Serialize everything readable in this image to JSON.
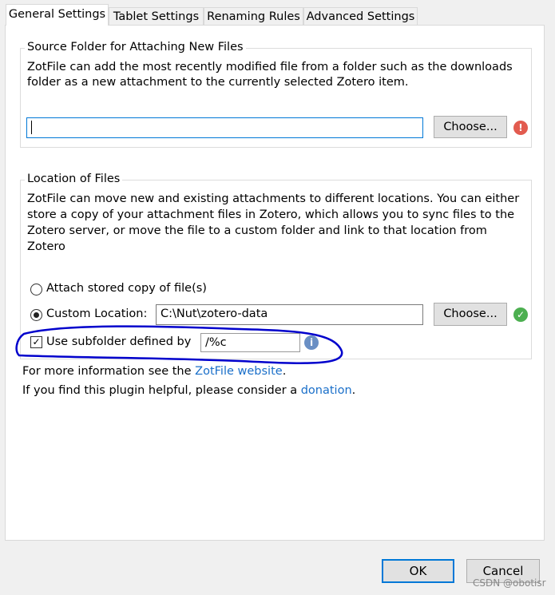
{
  "tabs": [
    {
      "label": "General Settings",
      "selected": true
    },
    {
      "label": "Tablet Settings"
    },
    {
      "label": "Renaming Rules"
    },
    {
      "label": "Advanced Settings"
    }
  ],
  "source": {
    "legend": "Source Folder for Attaching New Files",
    "desc1": "ZotFile can add the most recently modified file from a folder such as the downloads",
    "desc2": "folder as a new attachment to the currently selected Zotero item.",
    "value": "",
    "choose": "Choose...",
    "status_icon": "error-icon"
  },
  "location": {
    "legend": "Location of Files",
    "desc1": "ZotFile can move new and existing attachments to different locations. You can either",
    "desc2": "store a copy of your attachment files in Zotero, which allows you to sync files to the",
    "desc3": "Zotero server, or move the file to a custom folder and link to that location from",
    "desc4": "Zotero",
    "radio_stored": "Attach stored copy of file(s)",
    "radio_custom": "Custom Location:",
    "custom_selected": true,
    "custom_path": "C:\\Nut\\zotero-data",
    "choose": "Choose...",
    "status_icon": "success-icon",
    "subfolder_label": "Use subfolder defined by",
    "subfolder_checked": true,
    "subfolder_value": "/%c",
    "info_icon": "info-icon"
  },
  "footer": {
    "info_prefix": "For more information see the ",
    "info_link": "ZotFile website",
    "info_suffix": ".",
    "donate_prefix": "If you find this plugin helpful, please consider a ",
    "donate_link": "donation",
    "donate_suffix": "."
  },
  "buttons": {
    "ok": "OK",
    "cancel": "Cancel"
  },
  "watermark": "CSDN @obotisr",
  "annotation_color": "#0000cc"
}
